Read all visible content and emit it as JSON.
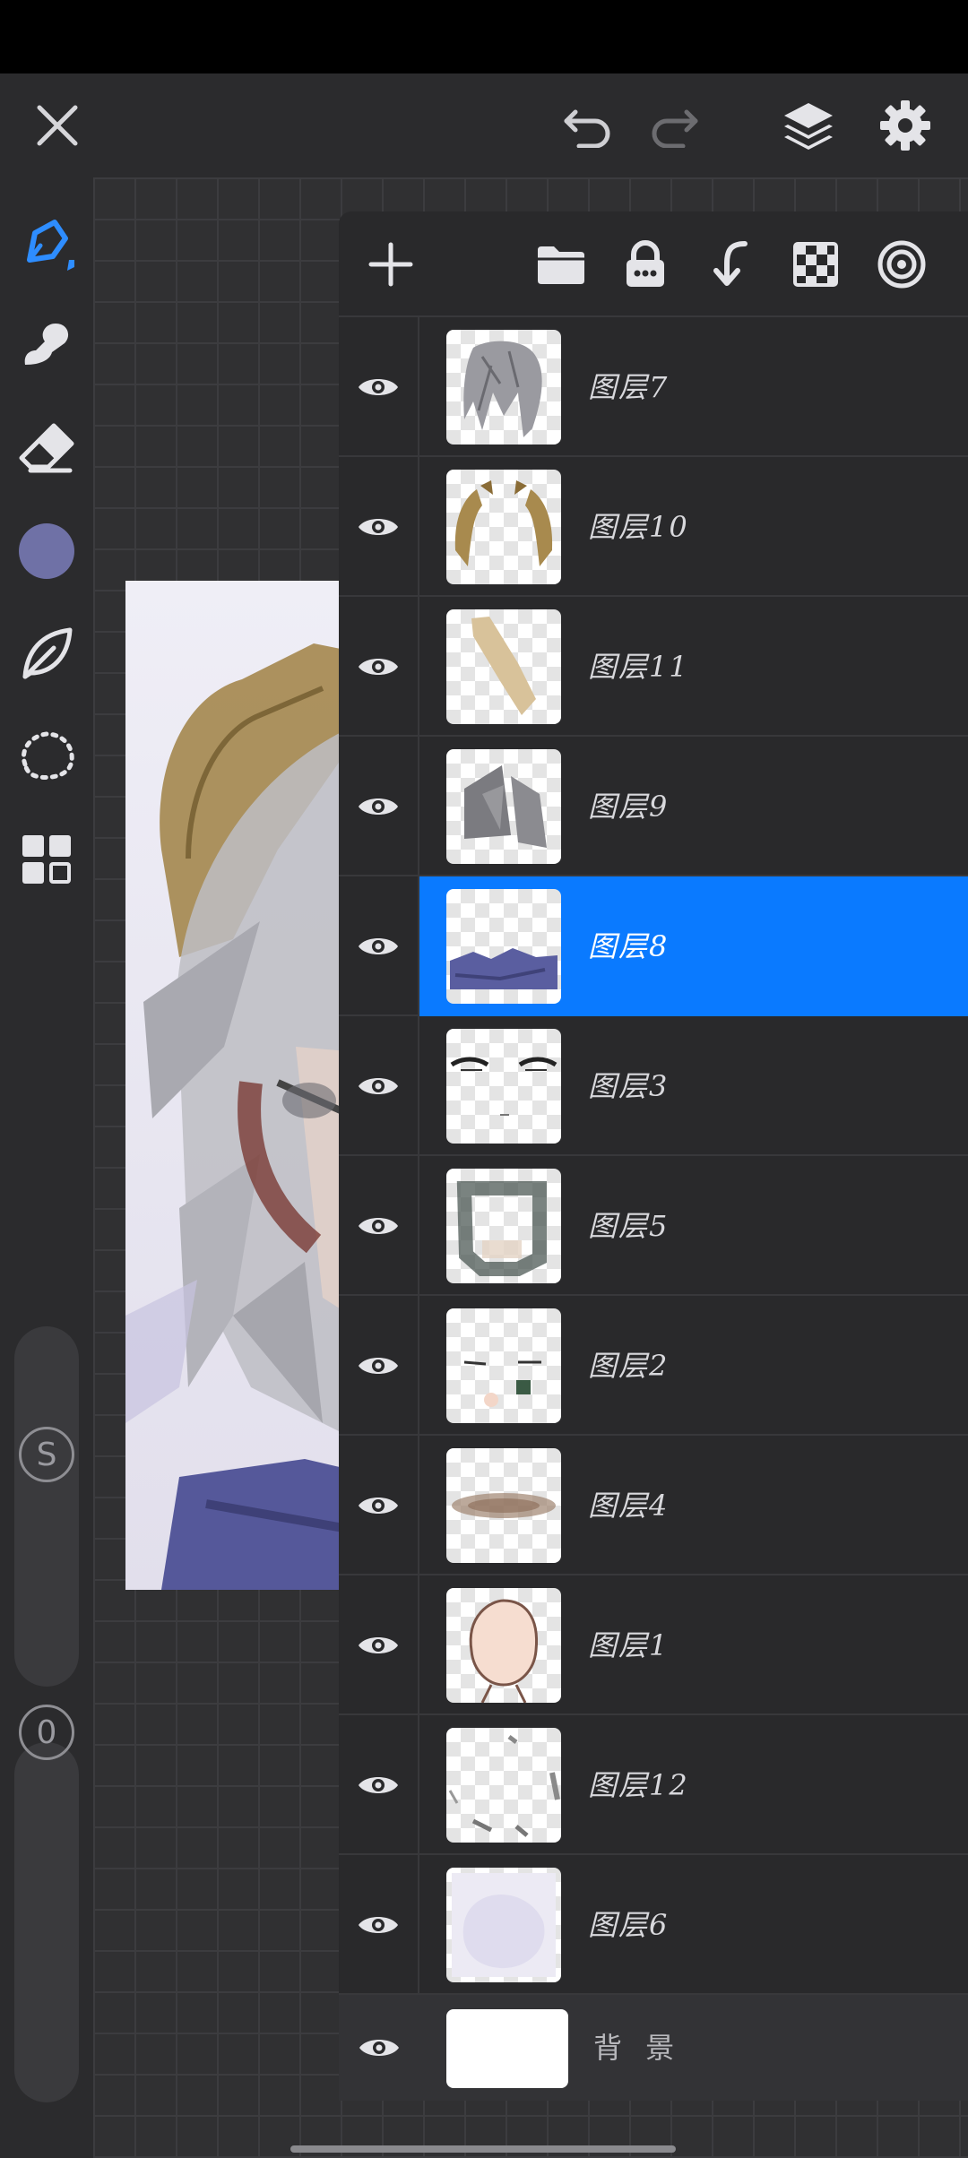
{
  "colors": {
    "accent": "#0a7aff",
    "current_color": "#6f71a6",
    "panel_bg": "#29292b",
    "toolbar_bg": "#2b2b2d"
  },
  "top_bar": {
    "icons": [
      "close-icon",
      "undo-icon",
      "redo-icon",
      "layers-icon",
      "settings-icon"
    ]
  },
  "left_toolbar": {
    "tools": [
      "pencil-icon",
      "smudge-icon",
      "eraser-icon",
      "color-swatch",
      "leaf-icon",
      "lasso-select-icon",
      "grid-icon"
    ],
    "size_slider_label": "S",
    "opacity_slider_label": "0"
  },
  "layers_panel": {
    "header_icons": [
      "add-icon",
      "folder-icon",
      "lock-icon",
      "merge-down-icon",
      "checkerboard-icon",
      "target-icon"
    ],
    "layers": [
      {
        "name": "图层7",
        "selected": false,
        "thumb": "hair"
      },
      {
        "name": "图层10",
        "selected": false,
        "thumb": "horns"
      },
      {
        "name": "图层11",
        "selected": false,
        "thumb": "stroke"
      },
      {
        "name": "图层9",
        "selected": false,
        "thumb": "grey"
      },
      {
        "name": "图层8",
        "selected": true,
        "thumb": "cloth"
      },
      {
        "name": "图层3",
        "selected": false,
        "thumb": "eyes"
      },
      {
        "name": "图层5",
        "selected": false,
        "thumb": "blur"
      },
      {
        "name": "图层2",
        "selected": false,
        "thumb": "face"
      },
      {
        "name": "图层4",
        "selected": false,
        "thumb": "brown"
      },
      {
        "name": "图层1",
        "selected": false,
        "thumb": "head"
      },
      {
        "name": "图层12",
        "selected": false,
        "thumb": "marks"
      },
      {
        "name": "图层6",
        "selected": false,
        "thumb": "light"
      }
    ],
    "background_layer": "背 景"
  }
}
